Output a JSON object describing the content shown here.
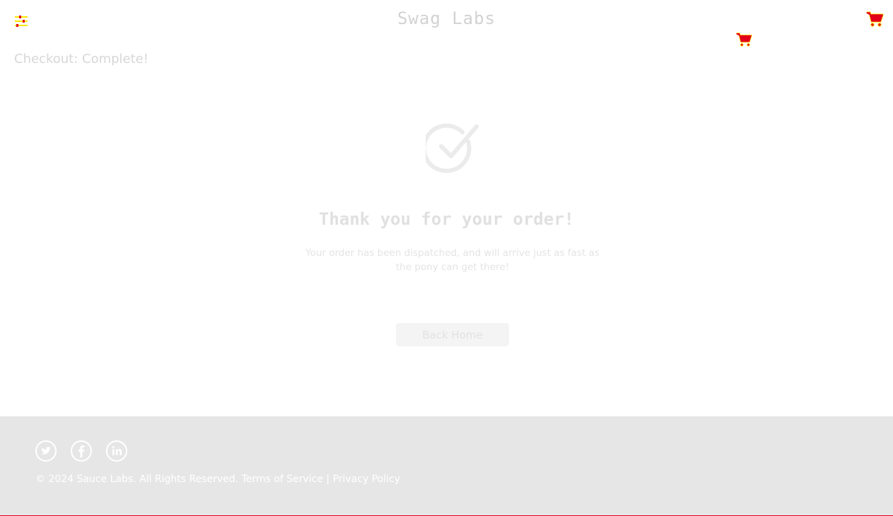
{
  "header": {
    "app_title": "Swag Labs",
    "menu_icon": "hamburger-menu-icon",
    "cart_icon": "shopping-cart-icon"
  },
  "subheader": {
    "title": "Checkout: Complete!"
  },
  "complete": {
    "check_icon": "checkmark-circle-icon",
    "header": "Thank you for your order!",
    "text": "Your order has been dispatched, and will arrive just as fast as the pony can get there!",
    "back_home_label": "Back Home"
  },
  "footer": {
    "social": [
      {
        "name": "Twitter",
        "icon": "twitter-icon"
      },
      {
        "name": "Facebook",
        "icon": "facebook-icon"
      },
      {
        "name": "LinkedIn",
        "icon": "linkedin-icon"
      }
    ],
    "copyright": "© 2024 Sauce Labs. All Rights Reserved.",
    "terms_label": "Terms of Service",
    "separator": "|",
    "privacy_label": "Privacy Policy"
  },
  "colors": {
    "brand_text": "#d2d2d2",
    "cart_red": "#e2001a",
    "cart_highlight": "#ffe400",
    "footer_bg": "#e6e6e6"
  }
}
